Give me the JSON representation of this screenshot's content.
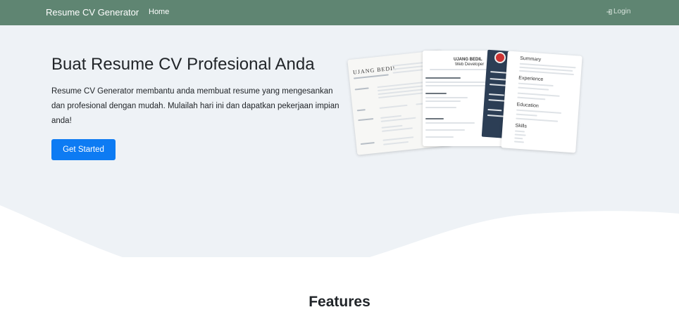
{
  "navbar": {
    "brand": "Resume CV Generator",
    "home": "Home",
    "login": "Login",
    "login_icon": "login-icon",
    "background": "#5f8572"
  },
  "hero": {
    "title": "Buat Resume CV Profesional Anda",
    "text": "Resume CV Generator membantu anda membuat resume yang mengesankan dan profesional dengan mudah. Mulailah hari ini dan dapatkan pekerjaan impian anda!",
    "cta": "Get Started",
    "cta_color": "#0d7bf3",
    "background": "#eef2f6",
    "preview": {
      "name_1": "UJANG BEDIL",
      "name_2": "UJANG BEDIL",
      "role": "Web Developer",
      "summary": "Summary",
      "experience": "Experience",
      "education": "Education",
      "skills": "Skills"
    }
  },
  "features": {
    "title": "Features"
  }
}
